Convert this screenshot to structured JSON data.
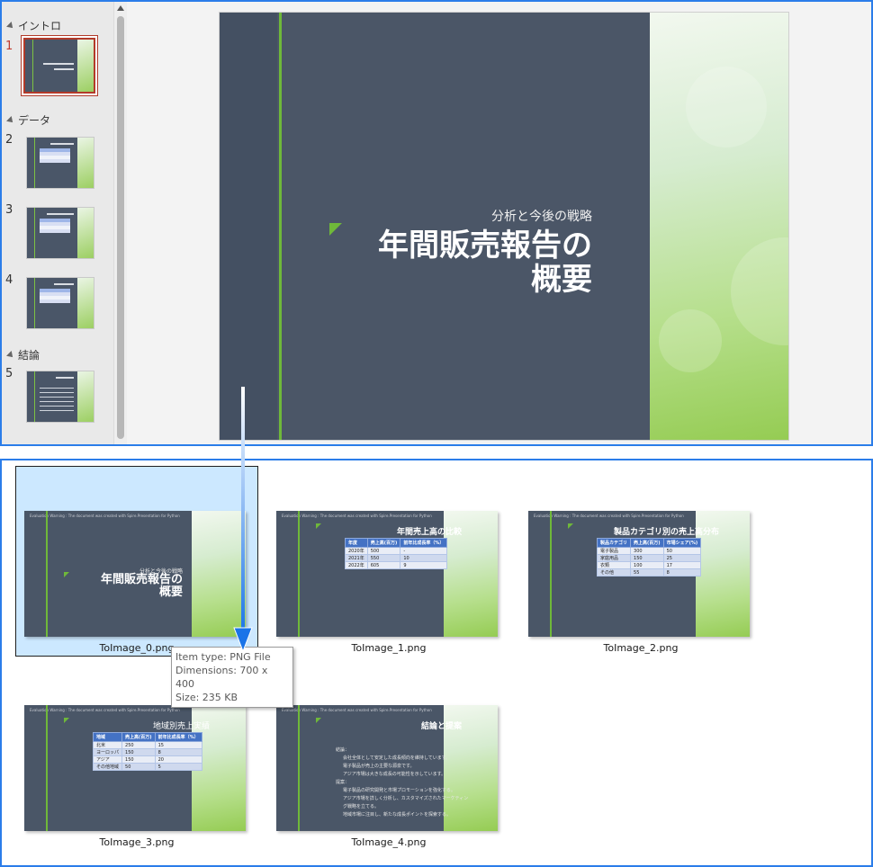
{
  "sidebar": {
    "sections": [
      {
        "label": "イントロ"
      },
      {
        "label": "データ"
      },
      {
        "label": "結論"
      }
    ],
    "slide_numbers": [
      "1",
      "2",
      "3",
      "4",
      "5"
    ]
  },
  "main_slide": {
    "subtitle": "分析と今後の戦略",
    "title_line1": "年間販売報告の",
    "title_line2": "概要"
  },
  "files": [
    {
      "name": "ToImage_0.png"
    },
    {
      "name": "ToImage_1.png"
    },
    {
      "name": "ToImage_2.png"
    },
    {
      "name": "ToImage_3.png"
    },
    {
      "name": "ToImage_4.png"
    }
  ],
  "thumb_header": "Evaluation Warning : The document was created with Spire.Presentation for Python",
  "slide_titles": {
    "s1_sub": "分析と今後の戦略",
    "s1_line1": "年間販売報告の",
    "s1_line2": "概要",
    "s2": "年間売上高の比較",
    "s3": "製品カテゴリ別の売上高分布",
    "s4": "地域別売上実績",
    "s5": "結論と提案"
  },
  "table_s2": {
    "headers": [
      "年度",
      "売上高(百万)",
      "前年比成長率（%）"
    ],
    "rows": [
      [
        "2020年",
        "500",
        "-"
      ],
      [
        "2021年",
        "550",
        "10"
      ],
      [
        "2022年",
        "605",
        "9"
      ]
    ]
  },
  "table_s3": {
    "headers": [
      "製品カテゴリ",
      "売上高(百万)",
      "市場シェア(%)"
    ],
    "rows": [
      [
        "電子製品",
        "300",
        "50"
      ],
      [
        "家庭用品",
        "150",
        "25"
      ],
      [
        "衣類",
        "100",
        "17"
      ],
      [
        "その他",
        "55",
        "8"
      ]
    ]
  },
  "table_s4": {
    "headers": [
      "地域",
      "売上高(百万)",
      "前年比成長率（%）"
    ],
    "rows": [
      [
        "北米",
        "250",
        "15"
      ],
      [
        "ヨーロッパ",
        "150",
        "8"
      ],
      [
        "アジア",
        "150",
        "20"
      ],
      [
        "その他地域",
        "50",
        "5"
      ]
    ]
  },
  "bullets_s5": [
    {
      "text": "結論：",
      "level": 1
    },
    {
      "text": "会社全体として安定した成長傾向を維持しています。",
      "level": 2
    },
    {
      "text": "電子製品が売上の主要な源泉です。",
      "level": 2
    },
    {
      "text": "アジア市場は大きな成長の可能性を示しています。",
      "level": 2
    },
    {
      "text": "提案：",
      "level": 1
    },
    {
      "text": "電子製品の研究開発と市場プロモーションを強化する。",
      "level": 2
    },
    {
      "text": "アジア市場を詳しく分析し、カスタマイズされたマーケティング戦略を立てる。",
      "level": 2
    },
    {
      "text": "地域市場に注目し、新たな成長ポイントを探索する。",
      "level": 2
    }
  ],
  "tooltip": {
    "type": "Item type: PNG File",
    "dimensions": "Dimensions: 700 x 400",
    "size": "Size: 235 KB"
  },
  "colors": {
    "accent_border": "#2b7de9",
    "slide_bg": "#4b5667",
    "slide_green": "#95cc53",
    "active_slide_border": "#b23a2a",
    "selection_bg": "#cce8ff"
  }
}
